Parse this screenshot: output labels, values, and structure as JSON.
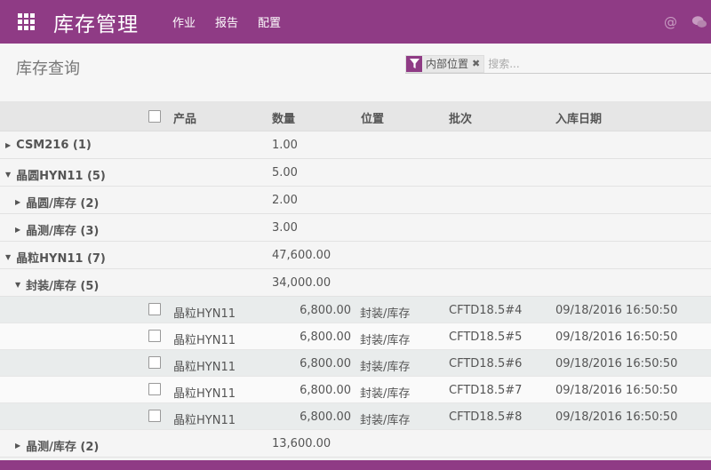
{
  "app": {
    "brand": "库存管理",
    "menu": [
      "作业",
      "报告",
      "配置"
    ],
    "accent_color": "#8f3b85"
  },
  "page": {
    "title": "库存查询"
  },
  "search": {
    "facet_label": "内部位置",
    "placeholder": "搜索..."
  },
  "table": {
    "headers": {
      "product": "产品",
      "quantity": "数量",
      "location": "位置",
      "lot": "批次",
      "in_date": "入库日期"
    },
    "groups": [
      {
        "label": "CSM216 (1)",
        "qty": "1.00",
        "expanded": false
      },
      {
        "label": "晶圆HYN11 (5)",
        "qty": "5.00",
        "expanded": true
      },
      {
        "label": "晶圆/库存 (2)",
        "qty": "2.00",
        "expanded": false
      },
      {
        "label": "晶测/库存 (3)",
        "qty": "3.00",
        "expanded": false
      },
      {
        "label": "晶粒HYN11 (7)",
        "qty": "47,600.00",
        "expanded": true
      },
      {
        "label": "封装/库存 (5)",
        "qty": "34,000.00",
        "expanded": true
      },
      {
        "label": "晶测/库存 (2)",
        "qty": "13,600.00",
        "expanded": false
      }
    ],
    "records": [
      {
        "product": "晶粒HYN11",
        "qty": "6,800.00",
        "location": "封装/库存",
        "lot": "CFTD18.5#4",
        "date": "09/18/2016 16:50:50"
      },
      {
        "product": "晶粒HYN11",
        "qty": "6,800.00",
        "location": "封装/库存",
        "lot": "CFTD18.5#5",
        "date": "09/18/2016 16:50:50"
      },
      {
        "product": "晶粒HYN11",
        "qty": "6,800.00",
        "location": "封装/库存",
        "lot": "CFTD18.5#6",
        "date": "09/18/2016 16:50:50"
      },
      {
        "product": "晶粒HYN11",
        "qty": "6,800.00",
        "location": "封装/库存",
        "lot": "CFTD18.5#7",
        "date": "09/18/2016 16:50:50"
      },
      {
        "product": "晶粒HYN11",
        "qty": "6,800.00",
        "location": "封装/库存",
        "lot": "CFTD18.5#8",
        "date": "09/18/2016 16:50:50"
      }
    ]
  }
}
